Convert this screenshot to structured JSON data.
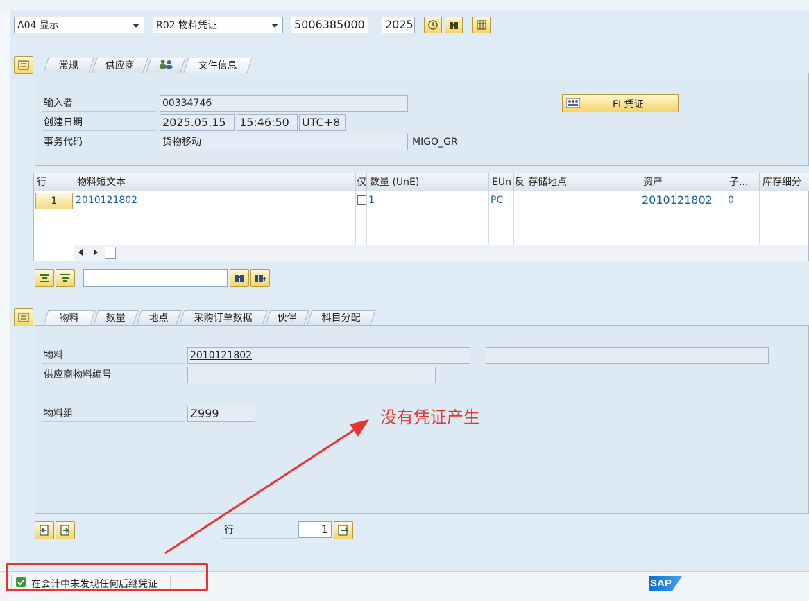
{
  "header": {
    "action_select": "A04 显示",
    "document_select": "R02 物料凭证",
    "document_number": "5006385000",
    "year": "2025"
  },
  "tabs_top": [
    {
      "label": "常规"
    },
    {
      "label": "供应商"
    },
    {
      "label": ""
    },
    {
      "label": "文件信息"
    }
  ],
  "doc_info": {
    "entered_by_label": "输入者",
    "entered_by": "00334746",
    "created_label": "创建日期",
    "created_date": "2025.05.15",
    "created_time": "15:46:50",
    "timezone": "UTC+8",
    "tcode_label": "事务代码",
    "tcode_text": "货物移动",
    "tcode": "MIGO_GR",
    "fi_button": "FI 凭证"
  },
  "grid": {
    "headers": [
      "行",
      "物料短文本",
      "仅",
      "数量 (UnE)",
      "EUn",
      "反",
      "存储地点",
      "资产",
      "子...",
      "库存细分"
    ],
    "row": {
      "line": "1",
      "material": "2010121802",
      "qty": "1",
      "unit": "PC",
      "asset": "2010121802",
      "sub": "0"
    }
  },
  "tabs_bottom": [
    {
      "label": "物料"
    },
    {
      "label": "数量"
    },
    {
      "label": "地点"
    },
    {
      "label": "采购订单数据"
    },
    {
      "label": "伙伴"
    },
    {
      "label": "科目分配"
    }
  ],
  "material_detail": {
    "material_label": "物料",
    "material_value": "2010121802",
    "vendor_mat_label": "供应商物料编号",
    "vendor_mat_value": "",
    "group_label": "物料组",
    "group_value": "Z999"
  },
  "annotation": {
    "text": "没有凭证产生",
    "color": "#e8342a"
  },
  "line_nav": {
    "label": "行",
    "value": "1"
  },
  "status": {
    "message": "在会计中未发现任何后继凭证",
    "logo": "SAP"
  },
  "icons": [
    "display-change-icon",
    "binoculars-icon",
    "grid-icon",
    "expand-icon",
    "people-icon",
    "fi-doc-icon",
    "align-top-icon",
    "filter-icon",
    "find-icon",
    "find-next-icon",
    "prev-item-icon",
    "next-item-icon",
    "go-icon",
    "checkmark-icon"
  ],
  "colors": {
    "accent_button": "#f4d76b",
    "link_blue": "#1a5f9e",
    "annotation_red": "#e8342a"
  }
}
